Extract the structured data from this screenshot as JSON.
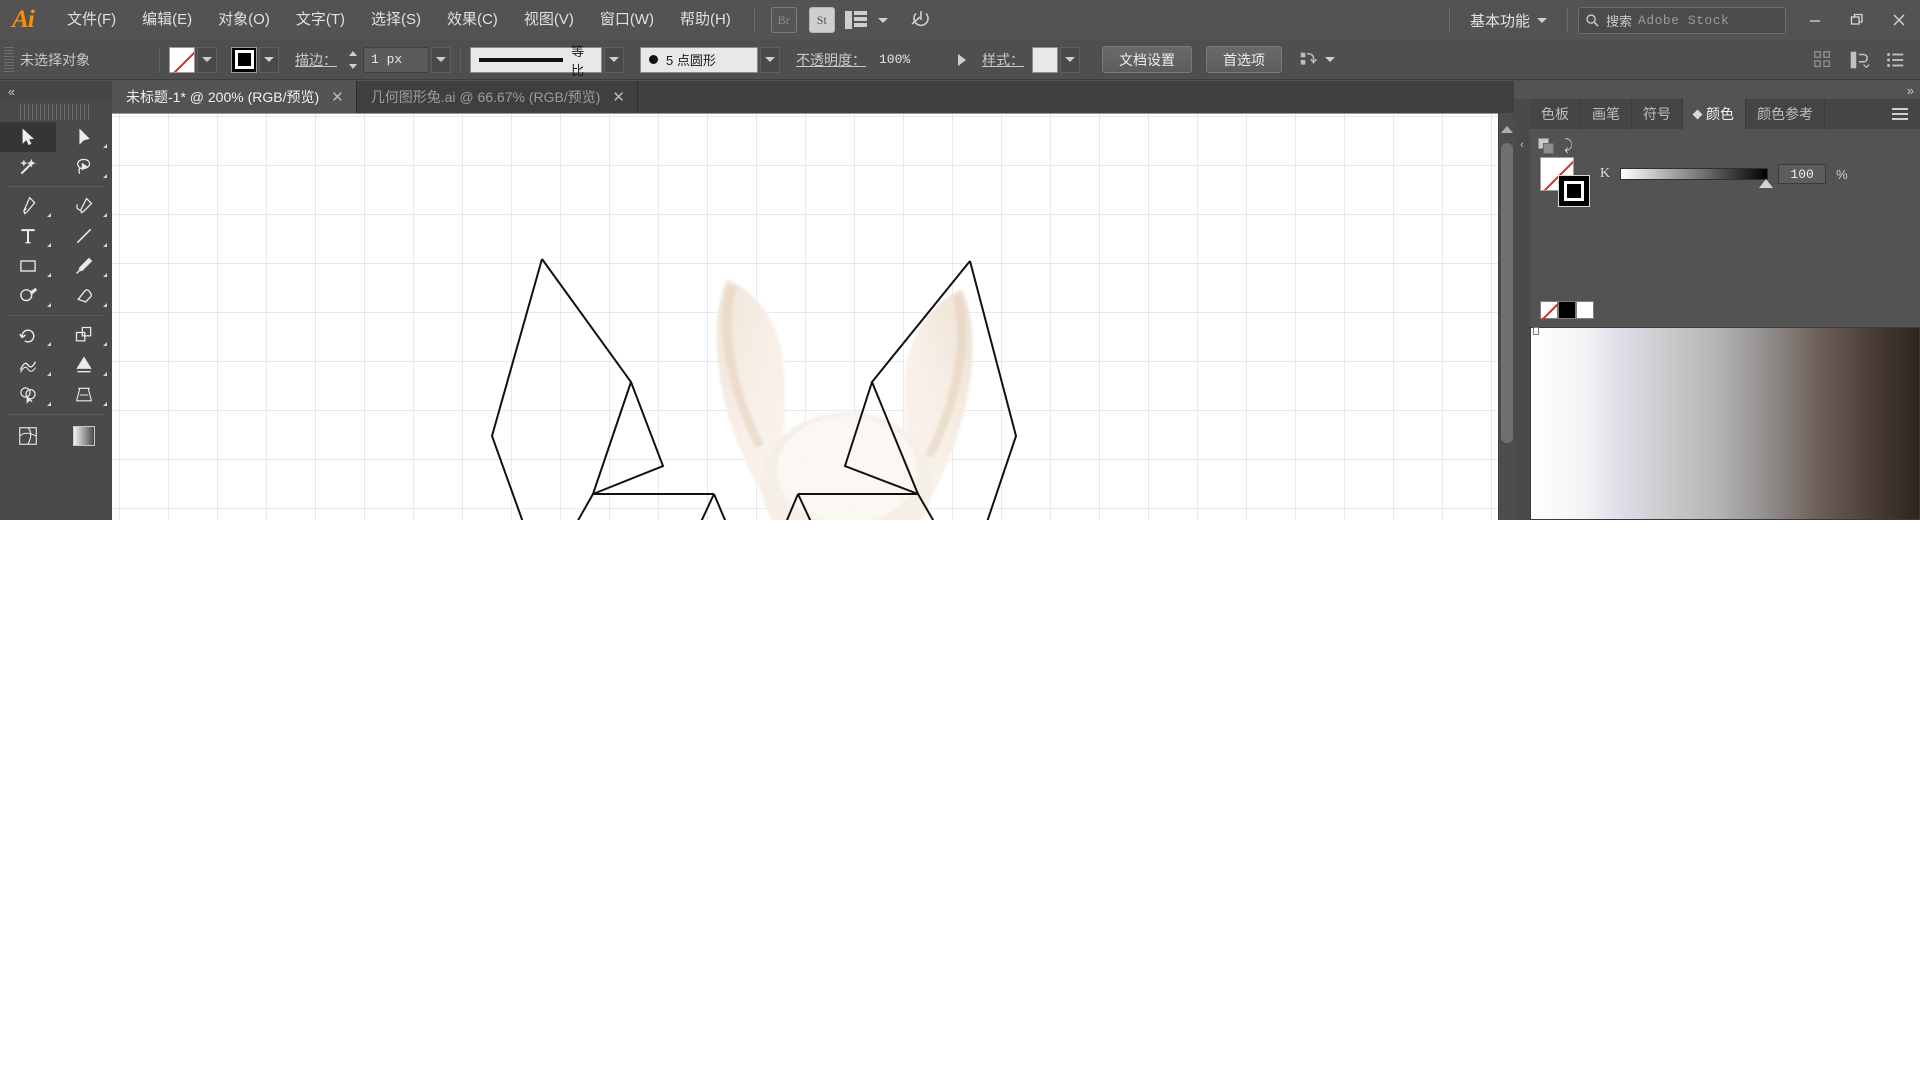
{
  "app": {
    "name": "Adobe Illustrator",
    "logo_text": "Ai"
  },
  "menubar": {
    "items": [
      {
        "label": "文件(F)",
        "name": "menu-file"
      },
      {
        "label": "编辑(E)",
        "name": "menu-edit"
      },
      {
        "label": "对象(O)",
        "name": "menu-object"
      },
      {
        "label": "文字(T)",
        "name": "menu-type"
      },
      {
        "label": "选择(S)",
        "name": "menu-select"
      },
      {
        "label": "效果(C)",
        "name": "menu-effect"
      },
      {
        "label": "视图(V)",
        "name": "menu-view"
      },
      {
        "label": "窗口(W)",
        "name": "menu-window"
      },
      {
        "label": "帮助(H)",
        "name": "menu-help"
      }
    ],
    "bridge_badge": "Br",
    "stock_badge": "St",
    "workspace": "基本功能",
    "search_label": "搜索",
    "search_placeholder": "Adobe Stock"
  },
  "controlbar": {
    "selection_status": "未选择对象",
    "stroke_label": "描边：",
    "stroke_width": "1 px",
    "profile_label": "等比",
    "brush_label": "5 点圆形",
    "opacity_label": "不透明度：",
    "opacity_value": "100%",
    "style_label": "样式：",
    "document_setup": "文档设置",
    "preferences": "首选项"
  },
  "tabs": [
    {
      "title": "未标题-1* @ 200% (RGB/预览)",
      "active": true,
      "close": "✕"
    },
    {
      "title": "几何图形兔.ai @ 66.67% (RGB/预览)",
      "active": false,
      "close": "✕"
    }
  ],
  "toolbar": {
    "collapse": "«",
    "tools": [
      {
        "name": "selection-tool",
        "selected": true
      },
      {
        "name": "direct-selection-tool",
        "selected": false
      },
      {
        "name": "magic-wand-tool",
        "selected": false
      },
      {
        "name": "lasso-tool",
        "selected": false
      },
      {
        "name": "pen-tool",
        "selected": false
      },
      {
        "name": "curvature-tool",
        "selected": false
      },
      {
        "name": "type-tool",
        "selected": false
      },
      {
        "name": "line-segment-tool",
        "selected": false
      },
      {
        "name": "rectangle-tool",
        "selected": false
      },
      {
        "name": "paintbrush-tool",
        "selected": false
      },
      {
        "name": "shaper-tool",
        "selected": false
      },
      {
        "name": "eraser-tool",
        "selected": false
      },
      {
        "name": "rotate-tool",
        "selected": false
      },
      {
        "name": "scale-tool",
        "selected": false
      },
      {
        "name": "width-tool",
        "selected": false
      },
      {
        "name": "free-transform-tool",
        "selected": false
      },
      {
        "name": "shape-builder-tool",
        "selected": false
      },
      {
        "name": "perspective-grid-tool",
        "selected": false
      },
      {
        "name": "mesh-tool",
        "selected": false
      },
      {
        "name": "gradient-tool",
        "selected": false
      }
    ]
  },
  "canvas": {
    "artwork_description": "白兔耳朵照片上的几何多边形描边路径",
    "grid_visible": true,
    "zoom": "200%"
  },
  "rightpanel": {
    "expand": "»",
    "tabs": [
      {
        "label": "色板",
        "active": false
      },
      {
        "label": "画笔",
        "active": false
      },
      {
        "label": "符号",
        "active": false
      },
      {
        "label": "颜色",
        "active": true
      },
      {
        "label": "颜色参考",
        "active": false
      }
    ],
    "color": {
      "channel_label": "K",
      "channel_value": "100",
      "percent_sign": "%"
    }
  },
  "colors": {
    "chrome_bg": "#535353",
    "chrome_dark": "#454545",
    "panel_bg": "#4a4a4a",
    "accent_orange": "#ff8f00",
    "text": "#d6d6d6",
    "canvas_bg": "#ffffff",
    "stroke_black": "#000000",
    "none_red": "#d42a2a"
  }
}
